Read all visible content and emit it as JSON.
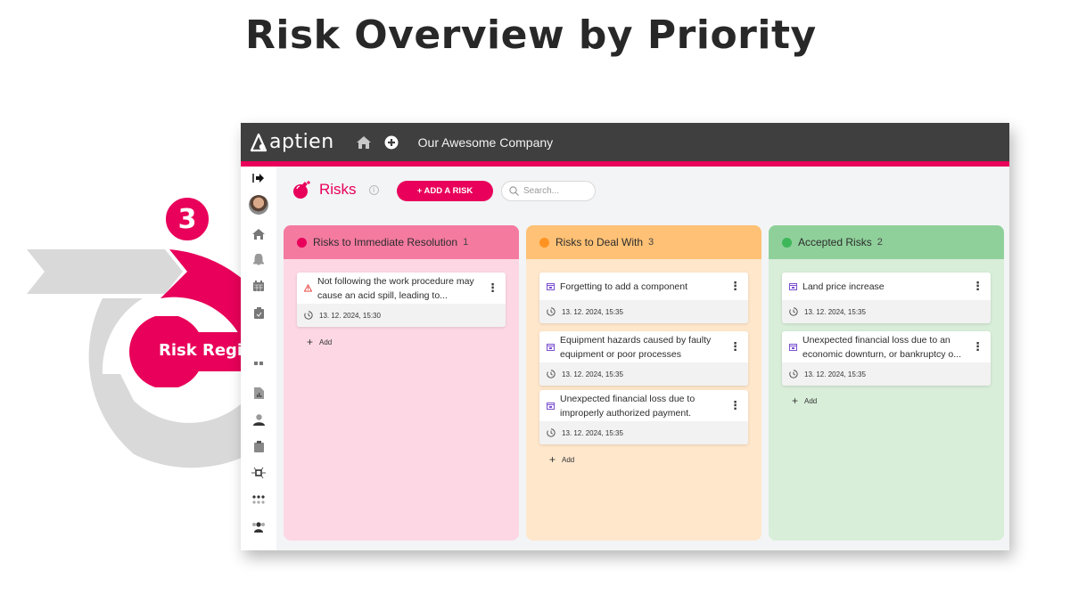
{
  "heading": "Risk Overview by Priority",
  "decor": {
    "step_number": "3",
    "step_label": "Risk Register",
    "accent_color": "#e8005a",
    "gray_color": "#d9d9d9"
  },
  "app": {
    "logo_text": "aptien",
    "company": "Our Awesome Company",
    "topbar_icons": [
      "home-icon",
      "plus-circle-icon"
    ]
  },
  "sidebar": {
    "items": [
      "collapse-icon",
      "avatar",
      "home-icon",
      "bell-icon",
      "calendar-icon",
      "clipboard-check-icon",
      "risk-register-icon",
      "report-icon",
      "user-icon",
      "clipboard-icon",
      "network-icon",
      "apps-grid-icon",
      "team-icon"
    ]
  },
  "toolbar": {
    "title": "Risks",
    "add_button": "+ ADD A RISK",
    "search_placeholder": "Search..."
  },
  "columns": [
    {
      "title": "Risks to Immediate Resolution",
      "count": "1",
      "dot_color": "#e8005a",
      "head_color": "#f47aa0",
      "body_color": "#fdd8e4",
      "add_label": "Add",
      "cards": [
        {
          "icon": "warning-icon",
          "title": "Not following the work procedure may cause an acid spill, leading to...",
          "date": "13. 12. 2024, 15:30"
        }
      ]
    },
    {
      "title": "Risks to Deal With",
      "count": "3",
      "dot_color": "#ff9322",
      "head_color": "#ffc175",
      "body_color": "#ffe7cc",
      "add_label": "Add",
      "cards": [
        {
          "icon": "calendar-lock-icon",
          "title": "Forgetting to add a component",
          "date": "13. 12. 2024, 15:35"
        },
        {
          "icon": "calendar-lock-icon",
          "title": "Equipment hazards caused by faulty equipment or poor processes",
          "date": "13. 12. 2024, 15:35"
        },
        {
          "icon": "calendar-lock-icon",
          "title": "Unexpected financial loss due to improperly authorized payment.",
          "date": "13. 12. 2024, 15:35"
        }
      ]
    },
    {
      "title": "Accepted Risks",
      "count": "2",
      "dot_color": "#3eb65a",
      "head_color": "#8fd09a",
      "body_color": "#d8eed9",
      "add_label": "Add",
      "cards": [
        {
          "icon": "calendar-lock-icon",
          "title": "Land price increase",
          "date": "13. 12. 2024, 15:35"
        },
        {
          "icon": "calendar-lock-icon",
          "title": "Unexpected financial loss due to an economic downturn, or bankruptcy o...",
          "date": "13. 12. 2024, 15:35"
        }
      ]
    }
  ]
}
